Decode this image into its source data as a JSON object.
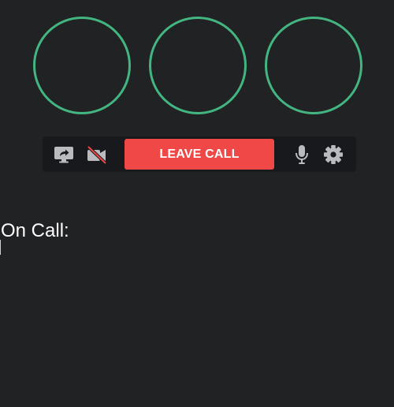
{
  "avatars": [
    {
      "ring_color": "#43b581"
    },
    {
      "ring_color": "#43b581"
    },
    {
      "ring_color": "#43b581"
    }
  ],
  "controls": {
    "screen_share_icon": "screen-share-icon",
    "camera_icon": "camera-off-icon",
    "leave_label": "LEAVE CALL",
    "leave_color": "#f04747",
    "mic_icon": "microphone-icon",
    "settings_icon": "gear-icon"
  },
  "participants": {
    "heading": "On Call:"
  },
  "colors": {
    "background": "#212224",
    "control_bar": "#18191c",
    "icon": "#b9bbbe",
    "accent_green": "#43b581"
  }
}
